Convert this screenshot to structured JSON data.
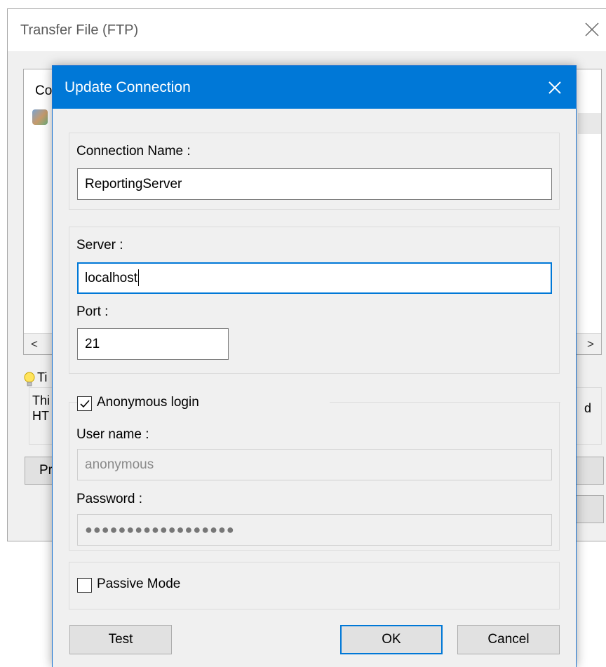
{
  "background_window": {
    "title": "Transfer File (FTP)",
    "list_header_partial": "Co",
    "tip_title_partial": "Ti",
    "tip_line1_partial": "Thi",
    "tip_line2_partial": "HT",
    "tip_tail": "d",
    "left_button_partial": "Pr",
    "scroll_left": "<",
    "scroll_right": ">"
  },
  "dialog": {
    "title": "Update Connection",
    "connection_name_label": "Connection Name :",
    "connection_name_value": "ReportingServer",
    "server_label": "Server :",
    "server_value": "localhost",
    "port_label": "Port :",
    "port_value": "21",
    "anonymous_label": "Anonymous login",
    "anonymous_checked": true,
    "username_label": "User name :",
    "username_value": "anonymous",
    "password_label": "Password :",
    "password_mask": "●●●●●●●●●●●●●●●●●●",
    "passive_label": "Passive Mode",
    "passive_checked": false,
    "buttons": {
      "test": "Test",
      "ok": "OK",
      "cancel": "Cancel"
    }
  },
  "colors": {
    "titlebar": "#0078d7",
    "dialog_bg": "#f0f0f0",
    "button_bg": "#e1e1e1",
    "focus_border": "#0078d7"
  },
  "icons": {
    "dialog_close": "close-icon",
    "background_close": "close-icon",
    "tip": "lightbulb-icon",
    "list_item": "server-connection-icon",
    "checkbox_checked": "checkmark-icon"
  }
}
